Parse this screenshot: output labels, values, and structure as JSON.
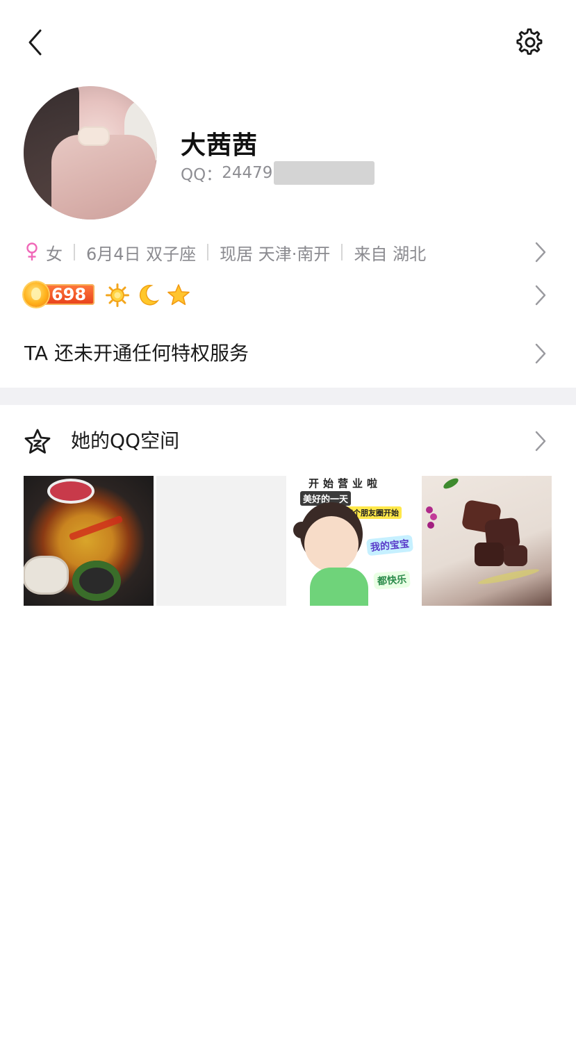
{
  "header": {
    "back_icon": "back-arrow-icon",
    "settings_icon": "gear-icon"
  },
  "profile": {
    "nickname": "大茜茜",
    "qq_label": "QQ：",
    "qq_visible": "24479"
  },
  "info": {
    "gender": "女",
    "birthday": "6月4日 双子座",
    "residence": "现居 天津·南开",
    "hometown": "来自 湖北"
  },
  "level": {
    "value": "698",
    "icons": [
      "sun-icon",
      "moon-icon",
      "star-icon"
    ]
  },
  "privilege": {
    "text": "TA 还未开通任何特权服务"
  },
  "qzone": {
    "title": "她的QQ空间",
    "photo_cartoon_header": "开始营业啦",
    "photo_cartoon_tag1": "美好的一天",
    "photo_cartoon_tag2": "从每个朋友圈开始",
    "photo_cartoon_sticker1": "我的宝宝",
    "photo_cartoon_sticker2": "都快乐"
  },
  "colors": {
    "accent_pink": "#f068b8",
    "level_orange": "#e8401a",
    "divider": "#f1f1f4",
    "secondary_text": "#8a8a8f"
  }
}
